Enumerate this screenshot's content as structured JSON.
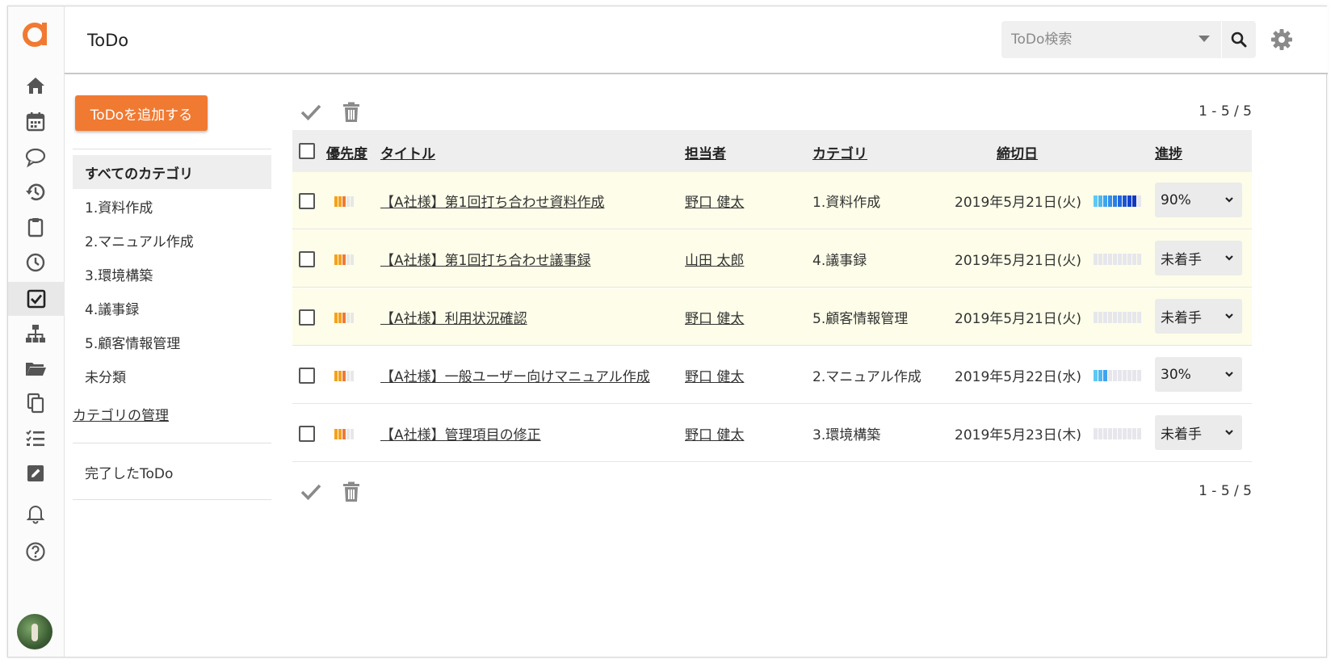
{
  "app": {
    "page_title": "ToDo",
    "accent_color": "#f07a32"
  },
  "search": {
    "placeholder": "ToDo検索"
  },
  "rail": {
    "icons": [
      "home-icon",
      "calendar-icon",
      "chat-icon",
      "history-icon",
      "clipboard-icon",
      "clock-icon",
      "todo-check-icon",
      "org-chart-icon",
      "folder-icon",
      "copy-icon",
      "checklist-icon",
      "edit-icon",
      "bell-icon",
      "help-icon"
    ],
    "active": "todo-check-icon"
  },
  "sidebar": {
    "add_button": "ToDoを追加する",
    "categories": [
      {
        "label": "すべてのカテゴリ",
        "active": true
      },
      {
        "label": "1.資料作成"
      },
      {
        "label": "2.マニュアル作成"
      },
      {
        "label": "3.環境構築"
      },
      {
        "label": "4.議事録"
      },
      {
        "label": "5.顧客情報管理"
      },
      {
        "label": "未分類"
      }
    ],
    "manage_link": "カテゴリの管理",
    "done_link": "完了したToDo"
  },
  "table": {
    "pager": "1 - 5 / 5",
    "headers": {
      "priority": "優先度",
      "title": "タイトル",
      "assignee": "担当者",
      "category": "カテゴリ",
      "due": "締切日",
      "progress": "進捗"
    },
    "rows": [
      {
        "title": "【A社様】第1回打ち合わせ資料作成",
        "assignee": "野口 健太",
        "category": "1.資料作成",
        "due": "2019年5月21日(火)",
        "progress": "90%",
        "progress_fraction": 0.9,
        "highlight": true
      },
      {
        "title": "【A社様】第1回打ち合わせ議事録",
        "assignee": "山田 太郎",
        "category": "4.議事録",
        "due": "2019年5月21日(火)",
        "progress": "未着手",
        "progress_fraction": 0,
        "highlight": true
      },
      {
        "title": "【A社様】利用状況確認",
        "assignee": "野口 健太",
        "category": "5.顧客情報管理",
        "due": "2019年5月21日(火)",
        "progress": "未着手",
        "progress_fraction": 0,
        "highlight": true
      },
      {
        "title": "【A社様】一般ユーザー向けマニュアル作成",
        "assignee": "野口 健太",
        "category": "2.マニュアル作成",
        "due": "2019年5月22日(水)",
        "progress": "30%",
        "progress_fraction": 0.3,
        "highlight": false
      },
      {
        "title": "【A社様】管理項目の修正",
        "assignee": "野口 健太",
        "category": "3.環境構築",
        "due": "2019年5月23日(木)",
        "progress": "未着手",
        "progress_fraction": 0,
        "highlight": false
      }
    ]
  }
}
